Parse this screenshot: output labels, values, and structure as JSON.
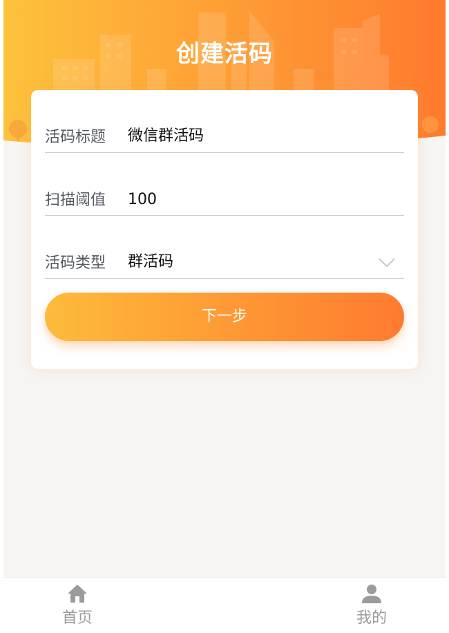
{
  "header": {
    "title": "创建活码"
  },
  "form": {
    "fields": [
      {
        "label": "活码标题",
        "value": "微信群活码"
      },
      {
        "label": "扫描阈值",
        "value": "100"
      },
      {
        "label": "活码类型",
        "value": "群活码"
      }
    ],
    "next_label": "下一步"
  },
  "tabbar": {
    "items": [
      {
        "label": "首页",
        "icon": "home-icon"
      },
      {
        "label": "我的",
        "icon": "user-icon"
      }
    ]
  },
  "colors": {
    "gradient_start": "#fdbb3a",
    "gradient_end": "#ff7a30",
    "background": "#f6f5f3",
    "inactive_tab": "#9b9b9b"
  }
}
